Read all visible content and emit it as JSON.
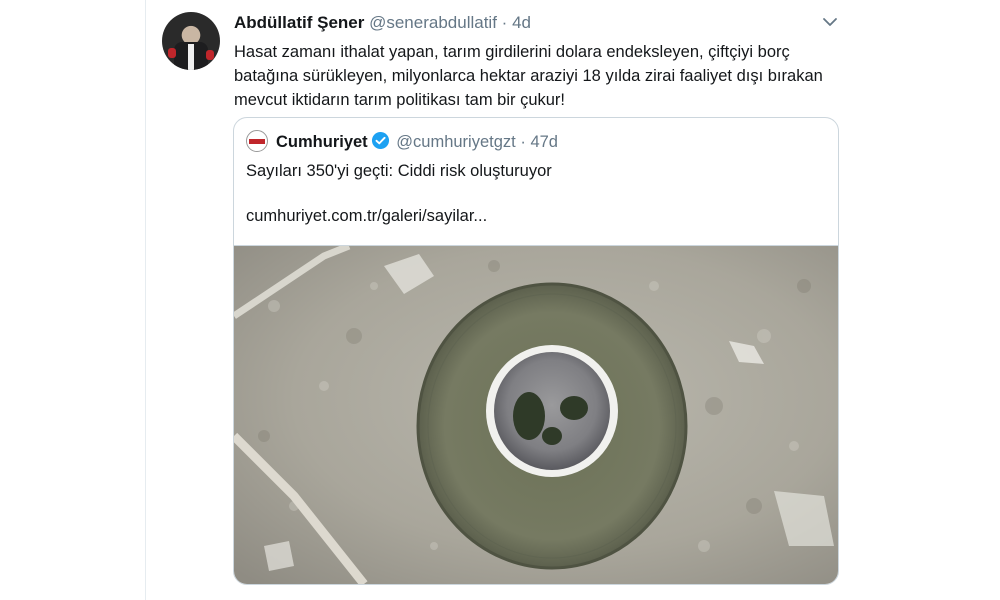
{
  "tweet": {
    "author_name": "Abdüllatif Şener",
    "author_handle": "@senerabdullatif",
    "separator": "·",
    "time": "4d",
    "text": "Hasat zamanı ithalat yapan, tarım girdilerini dolara endeksleyen, çiftçiyi borç batağına sürükleyen, milyonlarca hektar araziyi 18 yılda zirai faaliyet dışı bırakan mevcut iktidarın tarım politikası tam bir çukur!"
  },
  "quote": {
    "author_name": "Cumhuriyet",
    "author_handle": "@cumhuriyetgzt",
    "separator": "·",
    "time": "47d",
    "text": "Sayıları 350'yi geçti: Ciddi risk oluşturuyor",
    "link": "cumhuriyet.com.tr/galeri/sayilar..."
  },
  "icons": {
    "menu": "chevron-down-icon",
    "verified": "verified-badge-icon"
  },
  "colors": {
    "text": "#14171a",
    "secondary": "#657786",
    "border": "#ccd6dd",
    "verified": "#1da1f2"
  }
}
